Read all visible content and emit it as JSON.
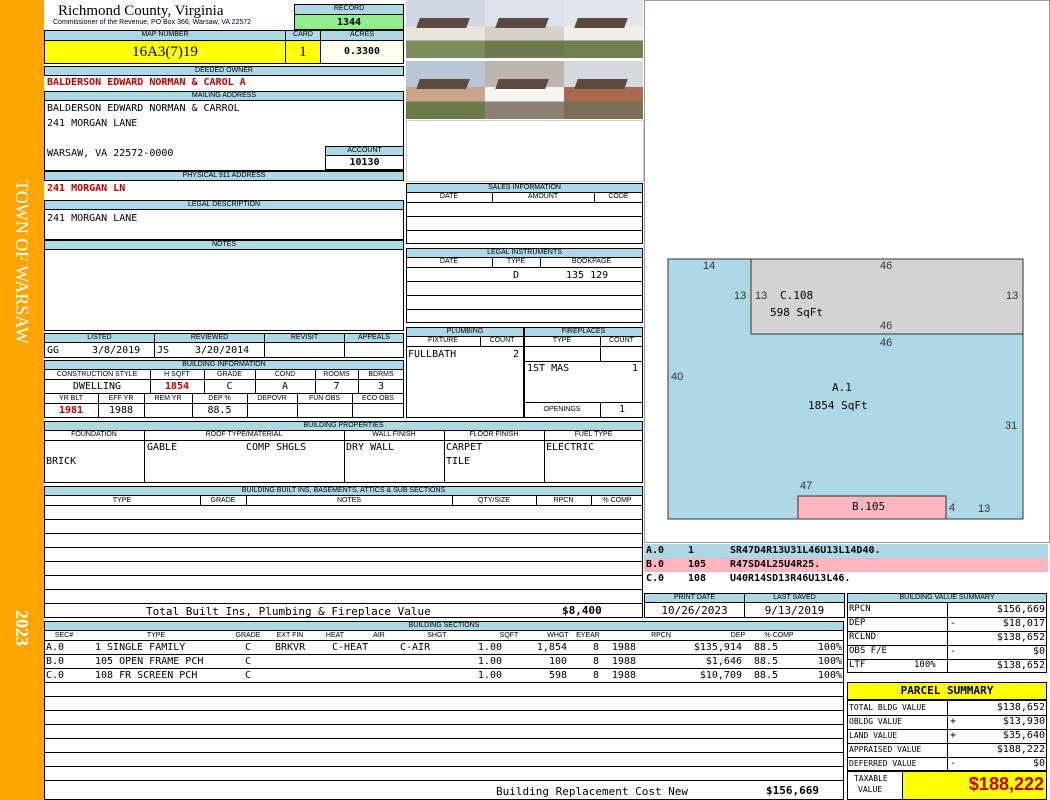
{
  "sidebar": {
    "town": "TOWN OF WARSAW",
    "year": "2023",
    "color": "#ffa500"
  },
  "header": {
    "county": "Richmond County, Virginia",
    "commissioner": "Commissioner of the Revenue, PO Box 366, Warsaw, VA 22572",
    "record_label": "RECORD",
    "record": "1344",
    "map_label": "MAP NUMBER",
    "map_number": "16A3(7)19",
    "card_label": "CARD",
    "card": "1",
    "acres_label": "ACRES",
    "acres": "0.3300"
  },
  "owner": {
    "deeded_label": "DEEDED OWNER",
    "deeded": "BALDERSON EDWARD NORMAN & CAROL A",
    "mailing_label": "MAILING ADDRESS",
    "mailing_1": "BALDERSON EDWARD NORMAN & CARROL",
    "mailing_2": "241 MORGAN LANE",
    "mailing_3": "WARSAW, VA 22572-0000",
    "account_label": "ACCOUNT",
    "account": "10130",
    "physical_label": "PHYSICAL 911 ADDRESS",
    "physical": "241 MORGAN LN",
    "legal_label": "LEGAL DESCRIPTION",
    "legal": "241 MORGAN LANE",
    "notes_label": "NOTES"
  },
  "listing": {
    "listed_label": "LISTED",
    "reviewed_label": "REVIEWED",
    "revisit_label": "REVISIT",
    "appeals_label": "APPEALS",
    "listed_by": "GG",
    "listed_date": "3/8/2019",
    "reviewed_by": "JS",
    "reviewed_date": "3/20/2014"
  },
  "building_info": {
    "title": "BUILDING INFORMATION",
    "h1": [
      "CONSTRUCTION STYLE",
      "H SQFT",
      "GRADE",
      "COND",
      "ROOMS",
      "BDRMS"
    ],
    "v1": [
      "DWELLING",
      "1854",
      "C",
      "A",
      "7",
      "3"
    ],
    "h2": [
      "YR BLT",
      "EFF YR",
      "REM YR",
      "DEP %",
      "DEPOVR",
      "FUN OBS",
      "ECO OBS"
    ],
    "v2": [
      "1981",
      "1988",
      "",
      "88.5",
      "",
      "",
      ""
    ]
  },
  "sales": {
    "title": "SALES INFORMATION",
    "headers": [
      "DATE",
      "AMOUNT",
      "CODE"
    ]
  },
  "legal_instruments": {
    "title": "LEGAL INSTRUMENTS",
    "headers": [
      "DATE",
      "TYPE",
      "BOOKPAGE"
    ],
    "row": [
      "",
      "D",
      "135 129"
    ]
  },
  "plumbing": {
    "title": "PLUMBING",
    "headers": [
      "FIXTURE",
      "COUNT"
    ],
    "row": [
      "FULLBATH",
      "2"
    ]
  },
  "fireplaces": {
    "title": "FIREPLACES",
    "headers": [
      "TYPE",
      "COUNT"
    ],
    "row": [
      "1ST MAS",
      "1"
    ],
    "openings_label": "OPENINGS",
    "openings": "1"
  },
  "properties": {
    "title": "BUILDING PROPERTIES",
    "headers": [
      "FOUNDATION",
      "ROOF TYPE/MATERIAL",
      "WALL FINISH",
      "FLOOR FINISH",
      "FUEL TYPE"
    ],
    "foundation": "BRICK",
    "roof_type": "GABLE",
    "roof_material": "COMP SHGLS",
    "wall": "DRY WALL",
    "floor_1": "CARPET",
    "floor_2": "TILE",
    "fuel": "ELECTRIC"
  },
  "builtins": {
    "title": "BUILDING BUILT INS, BASEMENTS, ATTICS & SUB SECTIONS",
    "headers": [
      "TYPE",
      "GRADE",
      "NOTES",
      "QTY/SIZE",
      "RPCN",
      "% COMP"
    ],
    "total_label": "Total Built Ins, Plumbing & Fireplace Value",
    "total": "$8,400"
  },
  "dates": {
    "print_label": "PRINT DATE",
    "print": "10/26/2023",
    "saved_label": "LAST SAVED",
    "saved": "9/13/2019"
  },
  "sections": {
    "title": "BUILDING SECTIONS",
    "headers": [
      "SEC#",
      "TYPE",
      "GRADE",
      "EXT FIN",
      "HEAT",
      "AIR",
      "SHGT",
      "SQFT",
      "WHGT",
      "EYEAR",
      "RPCN",
      "DEP",
      "% COMP"
    ],
    "rows": [
      [
        "A.0",
        "1 SINGLE FAMILY",
        "C",
        "BRKVR",
        "C-HEAT",
        "C-AIR",
        "1.00",
        "1,854",
        "8",
        "1988",
        "$135,914",
        "88.5",
        "100%"
      ],
      [
        "B.0",
        "105 OPEN FRAME PCH",
        "C",
        "",
        "",
        "",
        "1.00",
        "100",
        "8",
        "1988",
        "$1,646",
        "88.5",
        "100%"
      ],
      [
        "C.0",
        "108 FR SCREEN PCH",
        "C",
        "",
        "",
        "",
        "1.00",
        "598",
        "8",
        "1988",
        "$10,709",
        "88.5",
        "100%"
      ]
    ],
    "replacement_label": "Building Replacement Cost New",
    "replacement": "$156,669"
  },
  "sketch": {
    "labels": [
      {
        "id": "C.108",
        "sqft": "598 SqFt"
      },
      {
        "id": "A.1",
        "sqft": "1854 SqFt"
      },
      {
        "id": "B.105"
      }
    ],
    "dims": [
      "14",
      "46",
      "13",
      "13",
      "13",
      "46",
      "46",
      "40",
      "31",
      "47",
      "4",
      "13"
    ],
    "colors": {
      "main": "#add8e6",
      "screen": "#d3d3d3",
      "porch": "#ffb6c1"
    },
    "vectors": [
      {
        "sec": "A.0",
        "code": "1",
        "path": "SR47D4R13U31L46U13L14D40.",
        "color": "#add8e6"
      },
      {
        "sec": "B.0",
        "code": "105",
        "path": "R47SD4L25U4R25.",
        "color": "#ffb6c1"
      },
      {
        "sec": "C.0",
        "code": "108",
        "path": "U40R14SD13R46U13L46.",
        "color": "#ffffff"
      }
    ]
  },
  "value_summary": {
    "title": "BUILDING VALUE SUMMARY",
    "rows": [
      {
        "label": "RPCN",
        "sign": "",
        "value": "$156,669"
      },
      {
        "label": "DEP",
        "sign": "-",
        "value": "$18,017"
      },
      {
        "label": "RCLND",
        "sign": "",
        "value": "$138,652"
      },
      {
        "label": "OBS F/E",
        "sign": "-",
        "value": "$0"
      },
      {
        "label": "LTF",
        "pct": "100%",
        "sign": "",
        "value": "$138,652"
      }
    ]
  },
  "parcel": {
    "title": "PARCEL SUMMARY",
    "rows": [
      {
        "label": "TOTAL BLDG VALUE",
        "sign": "",
        "value": "$138,652"
      },
      {
        "label": "OBLDG VALUE",
        "sign": "+",
        "value": "$13,930"
      },
      {
        "label": "LAND VALUE",
        "sign": "+",
        "value": "$35,640"
      },
      {
        "label": "APPRAISED VALUE",
        "sign": "",
        "value": "$188,222"
      },
      {
        "label": "DEFERRED VALUE",
        "sign": "-",
        "value": "$0"
      }
    ],
    "taxable_label_1": "TAXABLE",
    "taxable_label_2": "VALUE",
    "taxable": "$188,222",
    "title_color": "#ffff00"
  }
}
